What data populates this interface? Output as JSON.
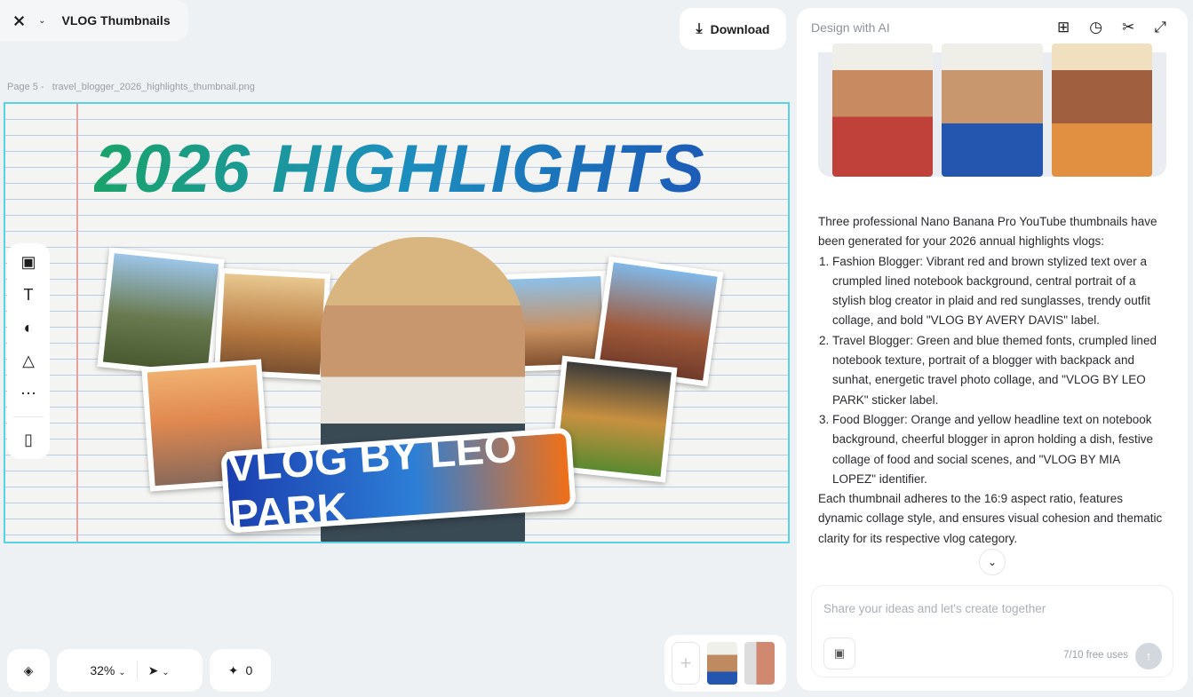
{
  "header": {
    "project_title": "VLOG Thumbnails",
    "download_label": "Download"
  },
  "canvas": {
    "page_label": "Page 5 -",
    "file_name": "travel_blogger_2026_highlights_thumbnail.png",
    "image_text": {
      "headline": "2026 HIGHLIGHTS",
      "banner": "VLOG BY LEO PARK"
    }
  },
  "toolbar": {
    "zoom": "32%",
    "credits": "0"
  },
  "panel": {
    "title": "Design with AI",
    "intro": "Three professional Nano Banana Pro YouTube thumbnails have been generated for your 2026 annual highlights vlogs:",
    "items": [
      "Fashion Blogger: Vibrant red and brown stylized text over a crumpled lined notebook background, central portrait of a stylish blog creator in plaid and red sunglasses, trendy outfit collage, and bold \"VLOG BY AVERY DAVIS\" label.",
      "Travel Blogger: Green and blue themed fonts, crumpled lined notebook texture, portrait of a blogger with backpack and sunhat, energetic travel photo collage, and \"VLOG BY LEO PARK\" sticker label.",
      "Food Blogger: Orange and yellow headline text on notebook background, cheerful blogger in apron holding a dish, festive collage of food and social scenes, and \"VLOG BY MIA LOPEZ\" identifier."
    ],
    "outro": "Each thumbnail adheres to the 16:9 aspect ratio, features dynamic collage style, and ensures visual cohesion and thematic clarity for its respective vlog category.",
    "input_placeholder": "Share your ideas and let's create together",
    "free_uses": "7/10 free uses"
  },
  "colors": {
    "selection": "#5ad2e6",
    "send_disabled": "#d3d8df"
  }
}
